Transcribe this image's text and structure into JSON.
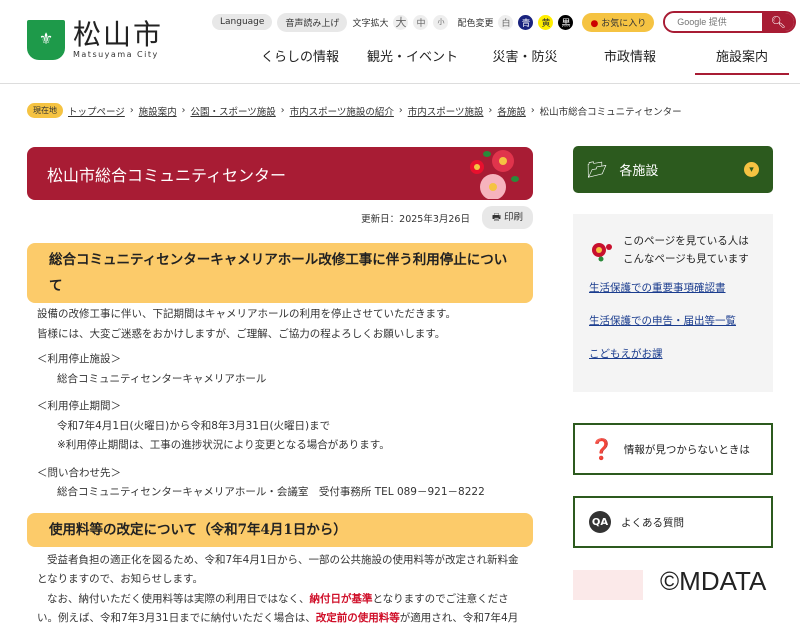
{
  "header": {
    "logo_mark": "松",
    "logo_jp": "松山市",
    "logo_en": "Matsuyama City",
    "language": "Language",
    "read_aloud": "音声読み上げ",
    "text_size_label": "文字拡大",
    "sizes": [
      "大",
      "中",
      "小"
    ],
    "color_label": "配色変更",
    "colors": [
      {
        "label": "白",
        "bg": "#eeeeee",
        "fg": "#666666"
      },
      {
        "label": "青",
        "bg": "#1a237e",
        "fg": "#ffffff"
      },
      {
        "label": "黄",
        "bg": "#ffee00",
        "fg": "#333333"
      },
      {
        "label": "黒",
        "bg": "#000000",
        "fg": "#ffffff"
      }
    ],
    "favorites": "お気に入り",
    "search_placeholder": "Google 提供"
  },
  "nav": [
    "くらしの情報",
    "観光・イベント",
    "災害・防災",
    "市政情報",
    "施設案内"
  ],
  "breadcrumb": {
    "here": "現在地",
    "links": [
      "トップページ",
      "施設案内",
      "公園・スポーツ施設",
      "市内スポーツ施設の紹介",
      "市内スポーツ施設",
      "各施設"
    ],
    "current": "松山市総合コミュニティセンター"
  },
  "page": {
    "title": "松山市総合コミュニティセンター",
    "updated": "更新日：2025年3月26日",
    "print": "印刷"
  },
  "section1": {
    "heading": "総合コミュニティセンターキャメリアホール改修工事に伴う利用停止について",
    "intro": [
      "設備の改修工事に伴い、下記期間はキャメリアホールの利用を停止させていただきます。",
      "皆様には、大変ご迷惑をおかけしますが、ご理解、ご協力の程よろしくお願いします。"
    ],
    "facility_label": "＜利用停止施設＞",
    "facility": "総合コミュニティセンターキャメリアホール",
    "period_label": "＜利用停止期間＞",
    "period": "令和7年4月1日(火曜日)から令和8年3月31日(火曜日)まで",
    "period_note": "※利用停止期間は、工事の進捗状況により変更となる場合があります。",
    "contact_label": "＜問い合わせ先＞",
    "contact": "総合コミュニティセンターキャメリアホール・会議室　受付事務所 TEL 089－921－8222"
  },
  "section2": {
    "heading": "使用料等の改定について（令和7年4月1日から）",
    "p1": "受益者負担の適正化を図るため、令和7年4月1日から、一部の公共施設の使用料等が改定され新料金となりますので、お知らせします。",
    "p2a": "なお、納付いただく使用料等は実際の利用日ではなく、",
    "p2b": "納付日が基準",
    "p2c": "となりますのでご注意ください。例えば、令和7年3月31日までに納付いただく場合は、",
    "p2d": "改定前の使用料等",
    "p2e": "が適用され、令和7年4月"
  },
  "sidebar": {
    "facilities": "各施設",
    "rec_heading1": "このページを見ている人は",
    "rec_heading2": "こんなページも見ています",
    "rec_links": [
      "生活保護での重要事項確認書",
      "生活保護での申告・届出等一覧",
      "こどもえがお課"
    ],
    "not_found": "情報が見つからないときは",
    "faq": "よくある質問"
  },
  "watermark": "©MDATA"
}
